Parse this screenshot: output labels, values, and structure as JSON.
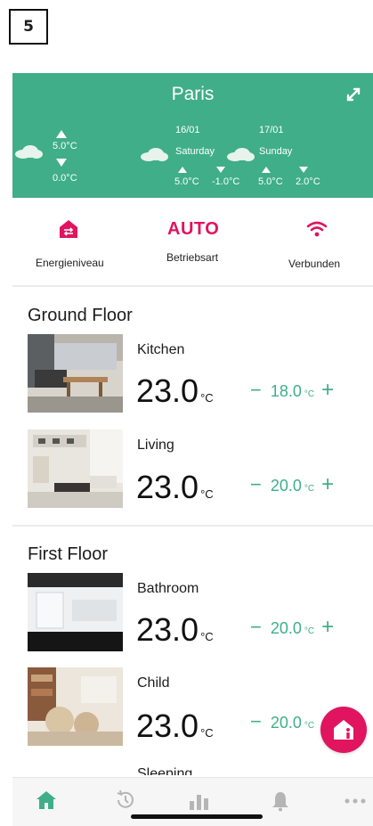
{
  "step_badge": "5",
  "weather": {
    "city": "Paris",
    "today": {
      "max": "5.0°C",
      "min": "0.0°C"
    },
    "forecast": [
      {
        "date": "16/01",
        "day": "Saturday",
        "max": "5.0°C",
        "min": "-1.0°C"
      },
      {
        "date": "17/01",
        "day": "Sunday",
        "max": "5.0°C",
        "min": "2.0°C"
      }
    ]
  },
  "status": {
    "energy_label": "Energieniveau",
    "mode_value": "AUTO",
    "mode_label": "Betriebsart",
    "connection_label": "Verbunden"
  },
  "floors": [
    {
      "name": "Ground Floor",
      "rooms": [
        {
          "name": "Kitchen",
          "temp": "23.0",
          "temp_unit": "°C",
          "setpoint": "18.0",
          "setpoint_unit": "°C"
        },
        {
          "name": "Living",
          "temp": "23.0",
          "temp_unit": "°C",
          "setpoint": "20.0",
          "setpoint_unit": "°C"
        }
      ]
    },
    {
      "name": "First Floor",
      "rooms": [
        {
          "name": "Bathroom",
          "temp": "23.0",
          "temp_unit": "°C",
          "setpoint": "20.0",
          "setpoint_unit": "°C"
        },
        {
          "name": "Child",
          "temp": "23.0",
          "temp_unit": "°C",
          "setpoint": "20.0",
          "setpoint_unit": "°C"
        },
        {
          "name": "Sleeping"
        }
      ]
    }
  ],
  "controls": {
    "minus": "−",
    "plus": "+"
  },
  "tabs": [
    "home-icon",
    "history-icon",
    "statistics-icon",
    "notifications-icon",
    "more-icon"
  ],
  "colors": {
    "accent": "#3fae89",
    "brand": "#e0145f"
  }
}
